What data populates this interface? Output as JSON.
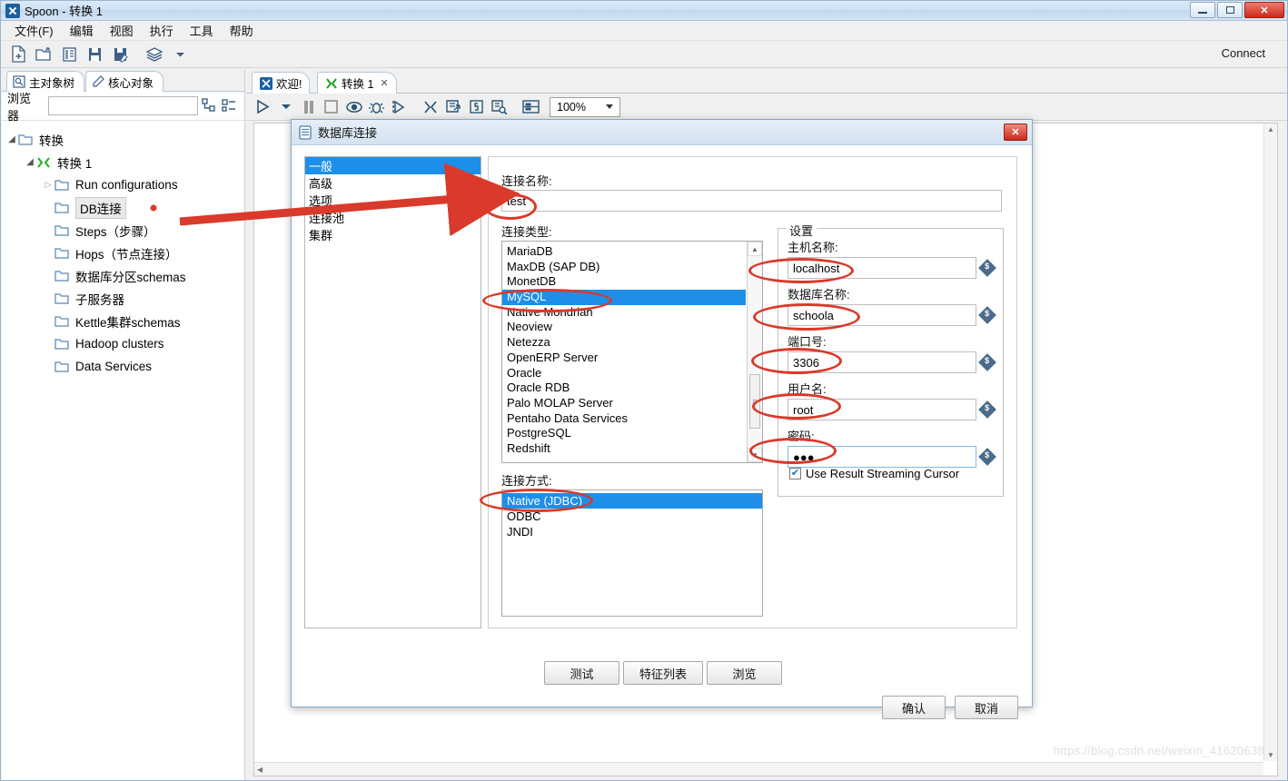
{
  "window": {
    "title": "Spoon - 转换 1",
    "app_icon": "spoon-icon",
    "minimize": "–",
    "maximize": "□",
    "close": "✕"
  },
  "menubar": {
    "items": [
      {
        "label": "文件(F)",
        "name": "menu-file"
      },
      {
        "label": "编辑",
        "name": "menu-edit"
      },
      {
        "label": "视图",
        "name": "menu-view"
      },
      {
        "label": "执行",
        "name": "menu-run"
      },
      {
        "label": "工具",
        "name": "menu-tools"
      },
      {
        "label": "帮助",
        "name": "menu-help"
      }
    ]
  },
  "toolbar": {
    "icons": [
      "new-file-icon",
      "open-folder-icon",
      "explorer-icon",
      "save-icon",
      "save-as-icon",
      "layers-icon",
      "dropdown-caret-icon"
    ],
    "connect_label": "Connect"
  },
  "left_panel": {
    "tabs": [
      {
        "label": "主对象树",
        "icon": "tree-view-icon",
        "active": true
      },
      {
        "label": "核心对象",
        "icon": "pencil-icon",
        "active": false
      }
    ],
    "browser": {
      "label": "浏览器",
      "value": "",
      "placeholder": "",
      "icons": [
        "collapse-all-icon",
        "expand-all-icon"
      ]
    },
    "tree": [
      {
        "label": "转换",
        "depth": 0,
        "arrow": "open",
        "icon": "folder-icon",
        "selected": false
      },
      {
        "label": "转换 1",
        "depth": 1,
        "arrow": "open",
        "icon": "transformation-icon",
        "selected": false
      },
      {
        "label": "Run configurations",
        "depth": 2,
        "arrow": "closed",
        "icon": "folder-icon",
        "selected": false
      },
      {
        "label": "DB连接",
        "depth": 2,
        "arrow": "none",
        "icon": "folder-icon",
        "selected": true
      },
      {
        "label": "Steps（步骤）",
        "depth": 2,
        "arrow": "none",
        "icon": "folder-icon",
        "selected": false
      },
      {
        "label": "Hops（节点连接）",
        "depth": 2,
        "arrow": "none",
        "icon": "folder-icon",
        "selected": false
      },
      {
        "label": "数据库分区schemas",
        "depth": 2,
        "arrow": "none",
        "icon": "folder-icon",
        "selected": false
      },
      {
        "label": "子服务器",
        "depth": 2,
        "arrow": "none",
        "icon": "folder-icon",
        "selected": false
      },
      {
        "label": "Kettle集群schemas",
        "depth": 2,
        "arrow": "none",
        "icon": "folder-icon",
        "selected": false
      },
      {
        "label": "Hadoop clusters",
        "depth": 2,
        "arrow": "none",
        "icon": "folder-icon",
        "selected": false
      },
      {
        "label": "Data Services",
        "depth": 2,
        "arrow": "none",
        "icon": "folder-icon",
        "selected": false
      }
    ]
  },
  "editor": {
    "tabs": [
      {
        "label": "欢迎!",
        "icon": "spoon-icon",
        "closable": false
      },
      {
        "label": "转换 1",
        "icon": "transformation-icon",
        "closable": true,
        "close": "✕"
      }
    ],
    "toolbar_icons": [
      "run-icon",
      "run-options-caret-icon",
      "pause-icon",
      "stop-icon",
      "preview-icon",
      "debug-icon",
      "replay-icon",
      "transformation-icon",
      "results-icon",
      "sql-icon",
      "search-metadata-icon",
      "grid-icon"
    ],
    "zoom": "100%",
    "watermark": "https://blog.csdn.net/weixin_41620638"
  },
  "dialog": {
    "title": "数据库连接",
    "icon": "database-icon",
    "close": "✕",
    "nav": [
      {
        "label": "一般",
        "selected": true
      },
      {
        "label": "高级",
        "selected": false
      },
      {
        "label": "选项",
        "selected": false
      },
      {
        "label": "连接池",
        "selected": false
      },
      {
        "label": "集群",
        "selected": false
      }
    ],
    "connection_name": {
      "label": "连接名称:",
      "value": "test"
    },
    "connection_type": {
      "label": "连接类型:",
      "options": [
        "MariaDB",
        "MaxDB (SAP DB)",
        "MonetDB",
        "MySQL",
        "Native Mondrian",
        "Neoview",
        "Netezza",
        "OpenERP Server",
        "Oracle",
        "Oracle RDB",
        "Palo MOLAP Server",
        "Pentaho Data Services",
        "PostgreSQL",
        "Redshift"
      ],
      "selected": "MySQL"
    },
    "access_method": {
      "label": "连接方式:",
      "options": [
        "Native (JDBC)",
        "ODBC",
        "JNDI"
      ],
      "selected": "Native (JDBC)"
    },
    "settings": {
      "group_label": "设置",
      "fields": [
        {
          "label": "主机名称:",
          "value": "localhost",
          "name": "hostname-field"
        },
        {
          "label": "数据库名称:",
          "value": "schoola",
          "name": "database-name-field"
        },
        {
          "label": "端口号:",
          "value": "3306",
          "name": "port-field"
        },
        {
          "label": "用户名:",
          "value": "root",
          "name": "username-field"
        },
        {
          "label": "密码:",
          "value": "●●●",
          "name": "password-field"
        }
      ],
      "checkbox": {
        "label": "Use Result Streaming Cursor",
        "checked": true,
        "mark": "✔"
      },
      "variable_icon": "variable-dollar-icon"
    },
    "buttons": {
      "test": "测试",
      "feature_list": "特征列表",
      "explore": "浏览",
      "ok": "确认",
      "cancel": "取消"
    }
  },
  "annotations": {
    "color": "#d93a2b",
    "arrow_from_label": "arrow-to-connection-name",
    "ellipses": [
      "ellipse-connection-name",
      "ellipse-mysql-option",
      "ellipse-native-jdbc",
      "ellipse-hostname",
      "ellipse-database-name",
      "ellipse-port",
      "ellipse-username",
      "ellipse-password"
    ],
    "dot": "dot-db-connections"
  }
}
